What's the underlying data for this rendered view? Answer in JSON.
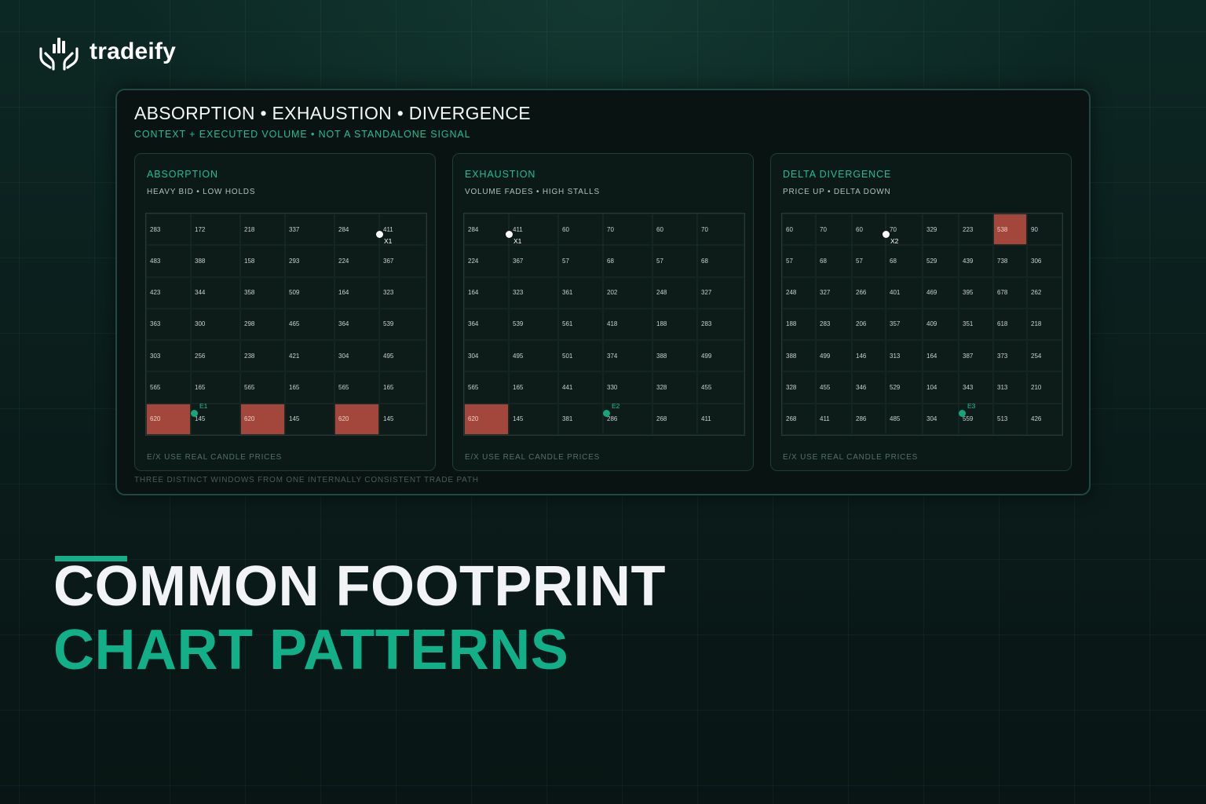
{
  "brand": {
    "name": "tradeify"
  },
  "panel": {
    "title": "ABSORPTION • EXHAUSTION • DIVERGENCE",
    "subtitle": "CONTEXT + EXECUTED VOLUME • NOT A STANDALONE SIGNAL",
    "footer": "THREE DISTINCT WINDOWS FROM ONE INTERNALLY CONSISTENT TRADE PATH"
  },
  "cards": [
    {
      "title": "ABSORPTION",
      "subtitle": "HEAVY BID • LOW HOLDS",
      "note": "E/X USE REAL CANDLE PRICES",
      "rows": [
        [
          "283",
          "172",
          "218",
          "337",
          "284",
          "411"
        ],
        [
          "483",
          "388",
          "158",
          "293",
          "224",
          "367"
        ],
        [
          "423",
          "344",
          "358",
          "509",
          "164",
          "323"
        ],
        [
          "363",
          "300",
          "298",
          "465",
          "364",
          "539"
        ],
        [
          "303",
          "256",
          "238",
          "421",
          "304",
          "495"
        ],
        [
          "565",
          "165",
          "565",
          "165",
          "565",
          "165"
        ],
        [
          "620",
          "145",
          "620",
          "145",
          "620",
          "145"
        ]
      ],
      "hot": [
        [
          6,
          0
        ],
        [
          6,
          2
        ],
        [
          6,
          4
        ]
      ],
      "markers": [
        {
          "kind": "exit",
          "label": "X1",
          "row": 0,
          "col": 5
        },
        {
          "kind": "entry",
          "label": "E1",
          "row": 6,
          "col": 1
        }
      ]
    },
    {
      "title": "EXHAUSTION",
      "subtitle": "VOLUME FADES • HIGH STALLS",
      "note": "E/X USE REAL CANDLE PRICES",
      "rows": [
        [
          "284",
          "411",
          "60",
          "70",
          "60",
          "70"
        ],
        [
          "224",
          "367",
          "57",
          "68",
          "57",
          "68"
        ],
        [
          "164",
          "323",
          "361",
          "202",
          "248",
          "327"
        ],
        [
          "364",
          "539",
          "561",
          "418",
          "188",
          "283"
        ],
        [
          "304",
          "495",
          "501",
          "374",
          "388",
          "499"
        ],
        [
          "565",
          "165",
          "441",
          "330",
          "328",
          "455"
        ],
        [
          "620",
          "145",
          "381",
          "286",
          "268",
          "411"
        ]
      ],
      "hot": [
        [
          6,
          0
        ]
      ],
      "markers": [
        {
          "kind": "exit",
          "label": "X1",
          "row": 0,
          "col": 1
        },
        {
          "kind": "entry",
          "label": "E2",
          "row": 6,
          "col": 3
        }
      ]
    },
    {
      "title": "DELTA DIVERGENCE",
      "subtitle": "PRICE UP • DELTA DOWN",
      "note": "E/X USE REAL CANDLE PRICES",
      "rows": [
        [
          "60",
          "70",
          "60",
          "70",
          "329",
          "223",
          "538",
          "90"
        ],
        [
          "57",
          "68",
          "57",
          "68",
          "529",
          "439",
          "738",
          "306"
        ],
        [
          "248",
          "327",
          "266",
          "401",
          "469",
          "395",
          "678",
          "262"
        ],
        [
          "188",
          "283",
          "206",
          "357",
          "409",
          "351",
          "618",
          "218"
        ],
        [
          "388",
          "499",
          "146",
          "313",
          "164",
          "387",
          "373",
          "254"
        ],
        [
          "328",
          "455",
          "346",
          "529",
          "104",
          "343",
          "313",
          "210"
        ],
        [
          "268",
          "411",
          "286",
          "485",
          "304",
          "559",
          "513",
          "426"
        ]
      ],
      "hot": [
        [
          0,
          6
        ]
      ],
      "markers": [
        {
          "kind": "exit",
          "label": "X2",
          "row": 0,
          "col": 3
        },
        {
          "kind": "entry",
          "label": "E3",
          "row": 6,
          "col": 5
        }
      ]
    }
  ],
  "headline": {
    "line1": "COMMON FOOTPRINT",
    "line2": "CHART PATTERNS"
  },
  "colors": {
    "accent": "#12b088",
    "hot_cell": "#a3463c",
    "panel_bg": "#081312"
  },
  "icons": {
    "logo": "hands-chart-icon"
  }
}
